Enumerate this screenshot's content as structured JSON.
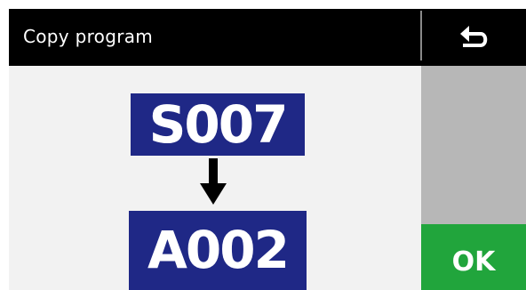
{
  "header": {
    "title": "Copy program",
    "back_icon": "back-arrow-icon"
  },
  "copy": {
    "source": "S007",
    "arrow_icon": "arrow-down-icon",
    "target": "A002"
  },
  "actions": {
    "ok_label": "OK"
  },
  "colors": {
    "header": "#000000",
    "program_box": "#1f2886",
    "side_panel": "#b7b7b7",
    "ok_button": "#21a53c"
  }
}
